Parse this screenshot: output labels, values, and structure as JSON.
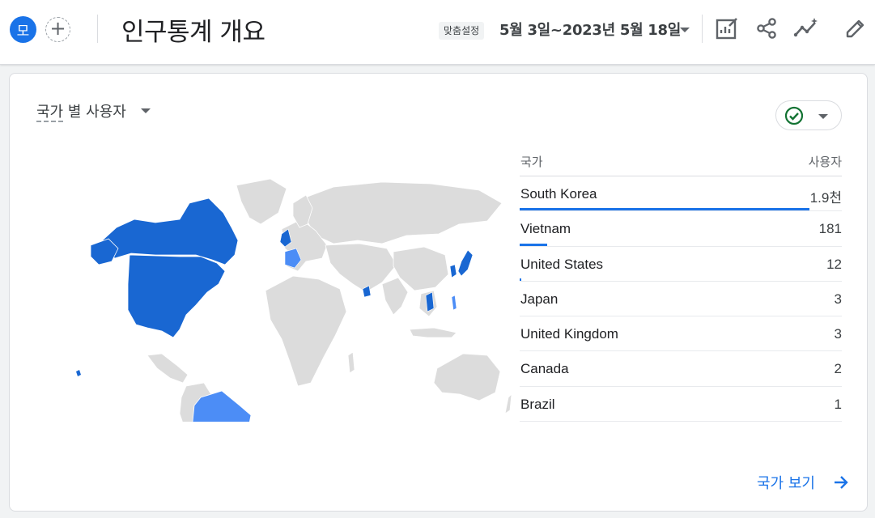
{
  "header": {
    "avatar_letter": "모",
    "add_symbol": "+",
    "title": "인구통계 개요",
    "date_chip": "맞춤설정",
    "date_range": "5월 3일~2023년 5월 18일",
    "icons": [
      "customize-report-icon",
      "share-icon",
      "insights-icon",
      "edit-icon"
    ]
  },
  "card": {
    "title_dimension": "국가",
    "title_rest": " 별 사용자",
    "table": {
      "col_country": "국가",
      "col_users": "사용자",
      "rows": [
        {
          "country": "South Korea",
          "users": "1.9천",
          "share": 1.0
        },
        {
          "country": "Vietnam",
          "users": "181",
          "share": 0.095
        },
        {
          "country": "United States",
          "users": "12",
          "share": 0.006
        },
        {
          "country": "Japan",
          "users": "3",
          "share": 0.0
        },
        {
          "country": "United Kingdom",
          "users": "3",
          "share": 0.0
        },
        {
          "country": "Canada",
          "users": "2",
          "share": 0.0
        },
        {
          "country": "Brazil",
          "users": "1",
          "share": 0.0
        }
      ]
    },
    "see_more": "국가 보기"
  },
  "colors": {
    "accent": "#1a73e8",
    "map_land": "#dcdcdc",
    "map_dark": "#1967d2",
    "map_light": "#4c8df6"
  }
}
